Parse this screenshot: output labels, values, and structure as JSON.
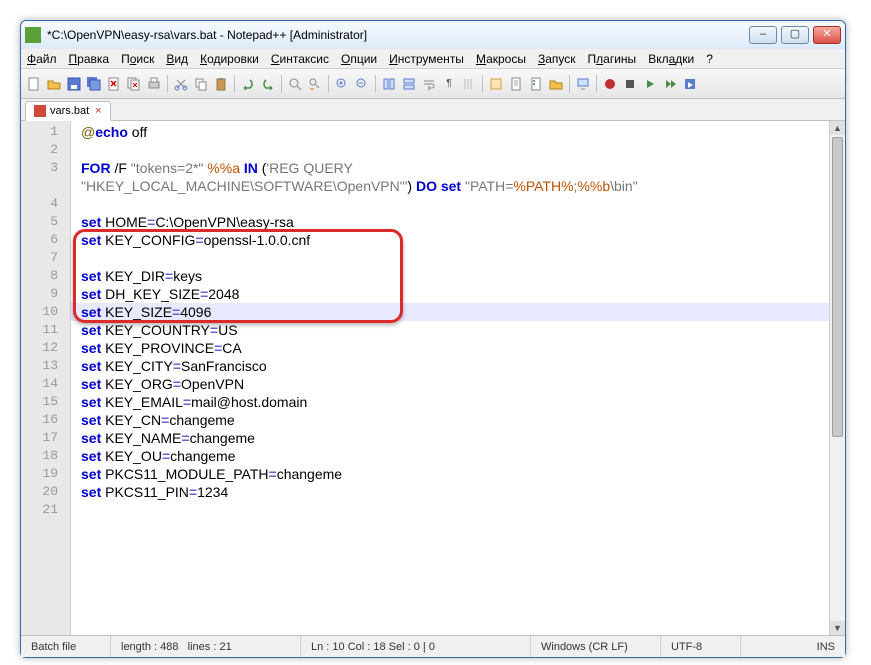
{
  "title": "*C:\\OpenVPN\\easy-rsa\\vars.bat - Notepad++ [Administrator]",
  "menu": {
    "file": "Файл",
    "edit": "Правка",
    "search": "Поиск",
    "view": "Вид",
    "encoding": "Кодировки",
    "syntax": "Синтаксис",
    "options": "Опции",
    "tools": "Инструменты",
    "macro": "Макросы",
    "run": "Запуск",
    "plugins": "Плагины",
    "tabs": "Вкладки",
    "help": "?"
  },
  "tab": {
    "label": "vars.bat",
    "close": "×"
  },
  "code": {
    "l1a": "@",
    "l1b": "echo",
    "l1c": " off",
    "l3a": "FOR",
    "l3b": " /F ",
    "l3c": "\"tokens=2*\"",
    "l3d": " ",
    "l3e": "%%a",
    "l3f": " ",
    "l3g": "IN",
    "l3h": " (",
    "l3i": "'REG QUERY",
    "l3j": "\"HKEY_LOCAL_MACHINE\\SOFTWARE\\OpenVPN\"'",
    "l3k": ") ",
    "l3l": "DO",
    "l3m": " ",
    "l3n": "set",
    "l3o": " ",
    "l3p": "\"PATH=",
    "l3q": "%PATH%",
    "l3r": ";",
    "l3s": "%%b",
    "l3t": "\\bin\"",
    "l5a": "set",
    "l5b": " HOME",
    "l5c": "=",
    "l5d": "C:\\OpenVPN\\easy-rsa",
    "l6a": "set",
    "l6b": " KEY_CONFIG",
    "l6c": "=",
    "l6d": "openssl-1.0.0.cnf",
    "l8a": "set",
    "l8b": " KEY_DIR",
    "l8c": "=",
    "l8d": "keys",
    "l9a": "set",
    "l9b": " DH_KEY_SIZE",
    "l9c": "=",
    "l9d": "2048",
    "l10a": "set",
    "l10b": " KEY_SIZE",
    "l10c": "=",
    "l10d": "4096",
    "l11a": "set",
    "l11b": " KEY_COUNTRY",
    "l11c": "=",
    "l11d": "US",
    "l12a": "set",
    "l12b": " KEY_PROVINCE",
    "l12c": "=",
    "l12d": "CA",
    "l13a": "set",
    "l13b": " KEY_CITY",
    "l13c": "=",
    "l13d": "SanFrancisco",
    "l14a": "set",
    "l14b": " KEY_ORG",
    "l14c": "=",
    "l14d": "OpenVPN",
    "l15a": "set",
    "l15b": " KEY_EMAIL",
    "l15c": "=",
    "l15d": "mail@host.domain",
    "l16a": "set",
    "l16b": " KEY_CN",
    "l16c": "=",
    "l16d": "changeme",
    "l17a": "set",
    "l17b": " KEY_NAME",
    "l17c": "=",
    "l17d": "changeme",
    "l18a": "set",
    "l18b": " KEY_OU",
    "l18c": "=",
    "l18d": "changeme",
    "l19a": "set",
    "l19b": " PKCS11_MODULE_PATH",
    "l19c": "=",
    "l19d": "changeme",
    "l20a": "set",
    "l20b": " PKCS11_PIN",
    "l20c": "=",
    "l20d": "1234"
  },
  "status": {
    "lang": "Batch file",
    "length": "length : 488",
    "lines": "lines : 21",
    "pos": "Ln : 10   Col : 18   Sel : 0 | 0",
    "eol": "Windows (CR LF)",
    "enc": "UTF-8",
    "ins": "INS"
  },
  "lineNumbers": [
    "1",
    "2",
    "3",
    "",
    "4",
    "5",
    "6",
    "7",
    "8",
    "9",
    "10",
    "11",
    "12",
    "13",
    "14",
    "15",
    "16",
    "17",
    "18",
    "19",
    "20",
    "21"
  ]
}
